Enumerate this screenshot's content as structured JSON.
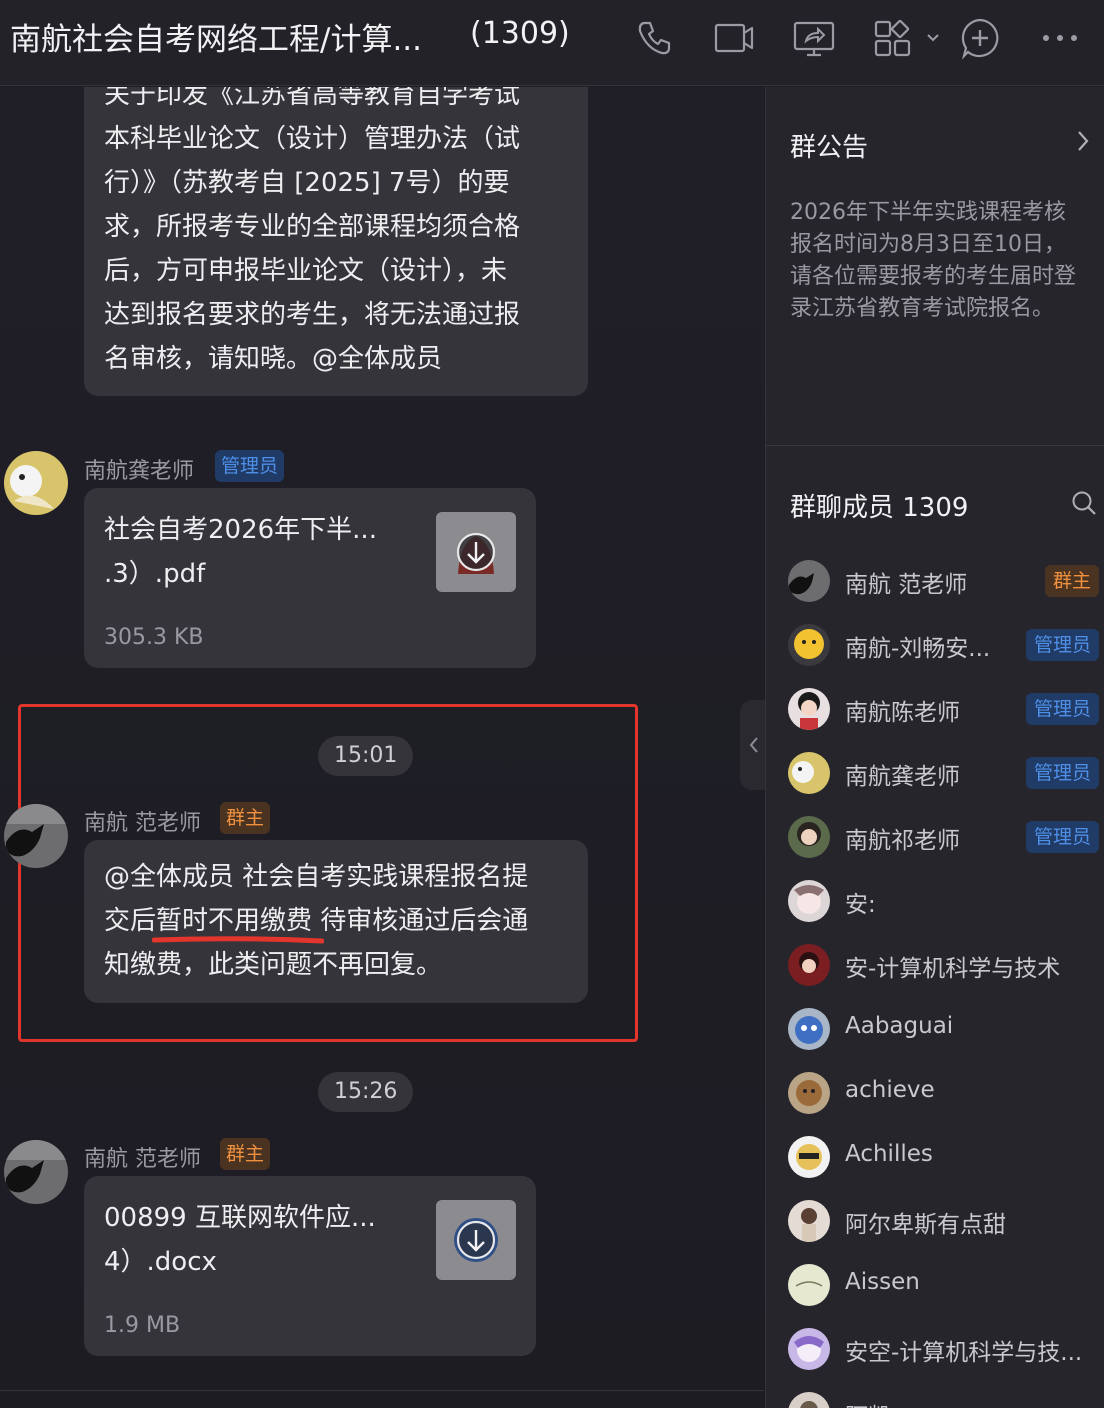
{
  "header": {
    "title": "南航社会自考网络工程/计算...",
    "member_count": "(1309)"
  },
  "messages": {
    "msg1_lines": [
      "关于印发《江苏省高等教育自学考试",
      "本科毕业论文（设计）管理办法（试",
      "行）》（苏教考自 [2025] 7号）的要",
      "求，所报考专业的全部课程均须合格",
      "后，方可申报毕业论文（设计），未",
      "达到报名要求的考生，将无法通过报",
      "名审核，请知晓。@全体成员"
    ],
    "msg2": {
      "sender": "南航龚老师",
      "badge": "管理员",
      "file_name_1": "社会自考2026年下半...",
      "file_name_2": ".3）.pdf",
      "file_size": "305.3 KB"
    },
    "time1": "15:01",
    "msg3": {
      "sender": "南航 范老师",
      "badge": "群主",
      "lines": [
        "@全体成员 社会自考实践课程报名提",
        "交后暂时不用缴费 待审核通过后会通",
        "知缴费，此类问题不再回复。"
      ]
    },
    "time2": "15:26",
    "msg4": {
      "sender": "南航 范老师",
      "badge": "群主",
      "file_name_1": "00899 互联网软件应...",
      "file_name_2": "4）.docx",
      "file_size": "1.9 MB"
    }
  },
  "panel": {
    "announcement_title": "群公告",
    "announcement_lines": [
      "2026年下半年实践课程考核",
      "报名时间为8月3日至10日，",
      "请各位需要报考的考生届时登",
      "录江苏省教育考试院报名。"
    ],
    "members_title": "群聊成员 1309",
    "members": [
      {
        "name": "南航 范老师",
        "badge": "群主"
      },
      {
        "name": "南航-刘畅安...",
        "badge": "管理员"
      },
      {
        "name": "南航陈老师",
        "badge": "管理员"
      },
      {
        "name": "南航龚老师",
        "badge": "管理员"
      },
      {
        "name": "南航祁老师",
        "badge": "管理员"
      },
      {
        "name": "安:",
        "badge": ""
      },
      {
        "name": "安-计算机科学与技术",
        "badge": ""
      },
      {
        "name": "Aabaguai",
        "badge": ""
      },
      {
        "name": "achieve",
        "badge": ""
      },
      {
        "name": "Achilles",
        "badge": ""
      },
      {
        "name": "阿尔卑斯有点甜",
        "badge": ""
      },
      {
        "name": "Aissen",
        "badge": ""
      },
      {
        "name": "安空-计算机科学与技...",
        "badge": ""
      },
      {
        "name": "阿凯",
        "badge": ""
      }
    ]
  },
  "colors": {
    "owner_badge": "#f0913f",
    "admin_badge": "#4f8fe8",
    "highlight_box": "#e2352b"
  }
}
